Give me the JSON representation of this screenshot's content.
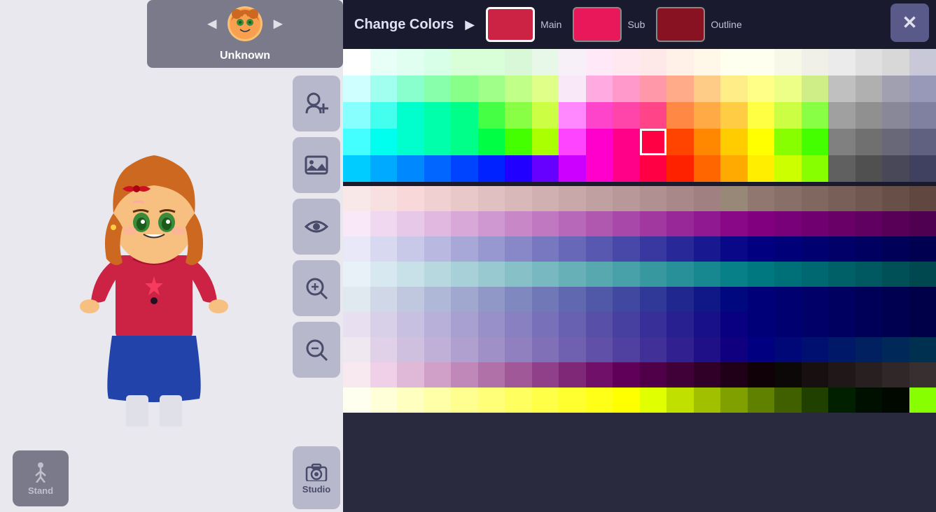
{
  "character": {
    "name": "Unknown",
    "nav_prev": "◂",
    "nav_next": "▸"
  },
  "header": {
    "change_colors_label": "Change Colors",
    "arrow": "▶",
    "main_label": "Main",
    "sub_label": "Sub",
    "outline_label": "Outline",
    "main_color": "#cc2244",
    "sub_color": "#e8185a",
    "outline_color": "#881122",
    "close_label": "✕"
  },
  "toolbar": {
    "add_character_icon": "👤",
    "image_icon": "🖼",
    "eye_icon": "👁",
    "zoom_in_icon": "⊕",
    "zoom_out_icon": "⊖",
    "studio_icon": "📷",
    "studio_label": "Studio"
  },
  "stand_button": {
    "label": "Stand"
  },
  "color_grid_top": {
    "rows": 5,
    "cols": 22,
    "cell_size": 38,
    "colors": [
      [
        "#ffffff",
        "#e8fff8",
        "#e0fff0",
        "#d8ffe8",
        "#d8ffd8",
        "#d8ffd8",
        "#d8f8d8",
        "#e8f8e8",
        "#f8f0f8",
        "#ffe8f8",
        "#ffe8f0",
        "#ffe8e8",
        "#fff0e8",
        "#fff8e8",
        "#fffff0",
        "#fffff0",
        "#f8f8e8",
        "#f0f0e8",
        "#ebebeb",
        "#e0e0e0",
        "#d8d8d8",
        "#c8c8d8"
      ],
      [
        "#d0ffff",
        "#a0ffee",
        "#88ffcc",
        "#88ffaa",
        "#88ff88",
        "#a0ff88",
        "#c0ff88",
        "#e0ff88",
        "#f8e8f8",
        "#ffaae0",
        "#ff99cc",
        "#ff99aa",
        "#ffaa88",
        "#ffcc88",
        "#ffee88",
        "#ffff88",
        "#eeff88",
        "#d0ee88",
        "#c0c0c0",
        "#b0b0b0",
        "#a0a0b0",
        "#9898b8"
      ],
      [
        "#88ffff",
        "#44ffee",
        "#00ffcc",
        "#00ffaa",
        "#00ff88",
        "#44ff44",
        "#88ff44",
        "#ccff44",
        "#ff88ff",
        "#ff44cc",
        "#ff44aa",
        "#ff4488",
        "#ff8844",
        "#ffaa44",
        "#ffcc44",
        "#ffff44",
        "#ccff44",
        "#88ff44",
        "#a0a0a0",
        "#909090",
        "#888898",
        "#8080a0"
      ],
      [
        "#44ffff",
        "#00ffee",
        "#00ffcc",
        "#00ffaa",
        "#00ff88",
        "#00ff44",
        "#44ff00",
        "#aaff00",
        "#ff44ff",
        "#ff00cc",
        "#ff0088",
        "#ff0044",
        "#ff4400",
        "#ff8800",
        "#ffcc00",
        "#ffff00",
        "#88ff00",
        "#44ff00",
        "#808080",
        "#707070",
        "#686878",
        "#606080"
      ],
      [
        "#00ccff",
        "#00aaff",
        "#0088ff",
        "#0066ff",
        "#0044ff",
        "#0022ff",
        "#2200ff",
        "#6600ff",
        "#cc00ff",
        "#ff00cc",
        "#ff0088",
        "#ff0044",
        "#ff2200",
        "#ff6600",
        "#ffaa00",
        "#ffee00",
        "#ccff00",
        "#88ff00",
        "#606060",
        "#505050",
        "#484858",
        "#404060"
      ]
    ]
  },
  "selected_cell": {
    "row": 3,
    "col": 11
  },
  "color_grid_bottom": {
    "rows": 9,
    "cols": 22,
    "colors": [
      [
        "#f8e8e8",
        "#f8e0e0",
        "#f8d8d8",
        "#f0d0d0",
        "#e8c8c8",
        "#e0c0c0",
        "#d8b8b8",
        "#d0b0b0",
        "#c8a8a8",
        "#c0a0a0",
        "#b89898",
        "#b09090",
        "#a88888",
        "#a08080",
        "#988878",
        "#907870",
        "#887068",
        "#806860",
        "#786058",
        "#705850",
        "#685048",
        "#604840"
      ],
      [
        "#f8e8f8",
        "#f0d8f0",
        "#e8c8e8",
        "#e0b8e0",
        "#d8a8d8",
        "#d098d0",
        "#c888c8",
        "#c078c0",
        "#b868b8",
        "#b058b0",
        "#a848a8",
        "#a038a0",
        "#982898",
        "#901890",
        "#880888",
        "#800080",
        "#780078",
        "#700070",
        "#680068",
        "#600060",
        "#580058",
        "#500050"
      ],
      [
        "#e8e8f8",
        "#d8d8f0",
        "#c8c8e8",
        "#b8b8e0",
        "#a8a8d8",
        "#9898d0",
        "#8888c8",
        "#7878c0",
        "#6868b8",
        "#5858b0",
        "#4848a8",
        "#3838a0",
        "#282898",
        "#181890",
        "#080888",
        "#000080",
        "#000078",
        "#000070",
        "#000068",
        "#000060",
        "#000058",
        "#000050"
      ],
      [
        "#e8f0f8",
        "#d8e8f0",
        "#c8e0e8",
        "#b8d8e0",
        "#a8d0d8",
        "#98c8d0",
        "#88c0c8",
        "#78b8c0",
        "#68b0b8",
        "#58a8b0",
        "#48a0a8",
        "#3898a0",
        "#289098",
        "#188890",
        "#088088",
        "#007880",
        "#007078",
        "#006870",
        "#006068",
        "#005860",
        "#005058",
        "#004850"
      ],
      [
        "#e0e8f0",
        "#d0d8e8",
        "#c0c8e0",
        "#b0b8d8",
        "#a0a8d0",
        "#9098c8",
        "#8088c0",
        "#7078b8",
        "#6068b0",
        "#5058a8",
        "#4048a0",
        "#303898",
        "#202890",
        "#101888",
        "#000880",
        "#000078",
        "#000070",
        "#000068",
        "#000060",
        "#000058",
        "#000050",
        "#000048"
      ],
      [
        "#e8e0f0",
        "#d8d0e8",
        "#c8c0e0",
        "#b8b0d8",
        "#a8a0d0",
        "#9890c8",
        "#8880c0",
        "#7870b8",
        "#6860b0",
        "#5850a8",
        "#4840a0",
        "#383098",
        "#282090",
        "#181088",
        "#080080",
        "#000078",
        "#000070",
        "#000068",
        "#000060",
        "#000058",
        "#000050",
        "#000048"
      ],
      [
        "#f0e8f0",
        "#e0d0e8",
        "#d0c0e0",
        "#c0b0d8",
        "#b0a0d0",
        "#a090c8",
        "#9080c0",
        "#8070b8",
        "#7060b0",
        "#6050a8",
        "#5040a0",
        "#403098",
        "#302090",
        "#201088",
        "#100080",
        "#000080",
        "#000878",
        "#001070",
        "#001868",
        "#002060",
        "#002858",
        "#003050"
      ],
      [
        "#f8e8f0",
        "#f0d0e8",
        "#e0b8d8",
        "#d0a0c8",
        "#c088b8",
        "#b070a8",
        "#a05898",
        "#904088",
        "#802878",
        "#701068",
        "#600058",
        "#500048",
        "#400038",
        "#300028",
        "#200018",
        "#100008",
        "#0c0808",
        "#181010",
        "#201818",
        "#282020",
        "#302828",
        "#383030"
      ],
      [
        "#fffff0",
        "#ffffd8",
        "#ffffc0",
        "#ffffa8",
        "#ffff90",
        "#ffff78",
        "#ffff60",
        "#ffff48",
        "#ffff30",
        "#ffff18",
        "#ffff00",
        "#e0ff00",
        "#c0e000",
        "#a0c000",
        "#80a000",
        "#608000",
        "#406000",
        "#204000",
        "#002000",
        "#001000",
        "#000800",
        "#88ff00"
      ]
    ]
  },
  "accent_color": "#3a3a5a",
  "header_bg": "#1a1a2e",
  "panel_bg": "#2a2a3e"
}
